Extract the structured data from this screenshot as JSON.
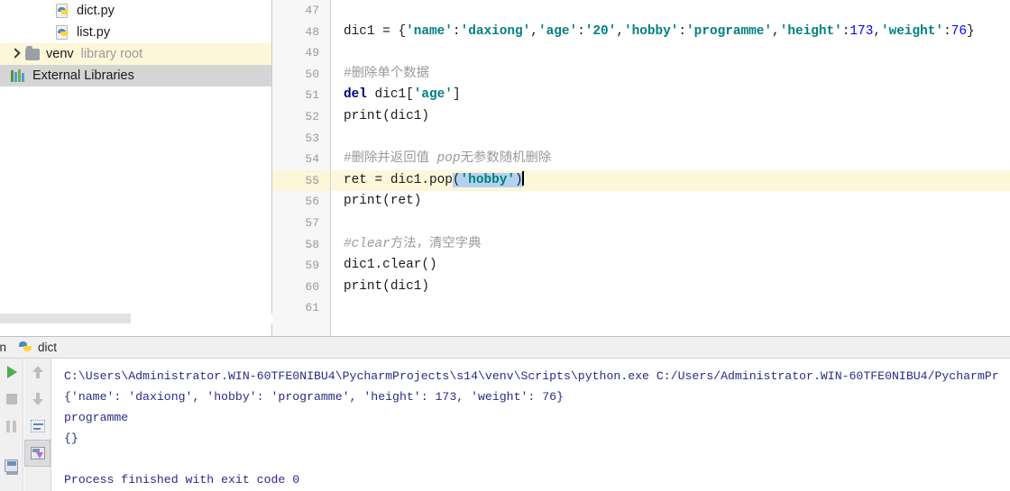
{
  "project_tree": {
    "items": [
      {
        "label": "dict.py",
        "sub": "",
        "icon": "python-file-icon",
        "indent": "indent3",
        "highlight": "none",
        "chevron": false
      },
      {
        "label": "list.py",
        "sub": "",
        "icon": "python-file-icon",
        "indent": "indent3",
        "highlight": "none",
        "chevron": false
      },
      {
        "label": "venv",
        "sub": "library root",
        "icon": "folder-icon",
        "indent": "indent1",
        "highlight": "hl-yellow",
        "chevron": true
      },
      {
        "label": "External Libraries",
        "sub": "",
        "icon": "books-icon",
        "indent": "indent0",
        "highlight": "hl-gray",
        "chevron": false
      }
    ]
  },
  "editor": {
    "first_line_number": 47,
    "current_line": 55,
    "lines": [
      {
        "n": 47,
        "tokens": []
      },
      {
        "n": 48,
        "tokens": [
          {
            "t": "plain",
            "s": "dic1 = {"
          },
          {
            "t": "str",
            "s": "'name'"
          },
          {
            "t": "plain",
            "s": ":"
          },
          {
            "t": "str",
            "s": "'daxiong'"
          },
          {
            "t": "plain",
            "s": ","
          },
          {
            "t": "str",
            "s": "'age'"
          },
          {
            "t": "plain",
            "s": ":"
          },
          {
            "t": "str",
            "s": "'20'"
          },
          {
            "t": "plain",
            "s": ","
          },
          {
            "t": "str",
            "s": "'hobby'"
          },
          {
            "t": "plain",
            "s": ":"
          },
          {
            "t": "str",
            "s": "'programme'"
          },
          {
            "t": "plain",
            "s": ","
          },
          {
            "t": "str",
            "s": "'height'"
          },
          {
            "t": "plain",
            "s": ":"
          },
          {
            "t": "num",
            "s": "173"
          },
          {
            "t": "plain",
            "s": ","
          },
          {
            "t": "str",
            "s": "'weight'"
          },
          {
            "t": "plain",
            "s": ":"
          },
          {
            "t": "num",
            "s": "76"
          },
          {
            "t": "plain",
            "s": "}"
          }
        ]
      },
      {
        "n": 49,
        "tokens": []
      },
      {
        "n": 50,
        "tokens": [
          {
            "t": "cmt",
            "s": "#删除单个数据"
          }
        ]
      },
      {
        "n": 51,
        "tokens": [
          {
            "t": "kw",
            "s": "del"
          },
          {
            "t": "plain",
            "s": " dic1["
          },
          {
            "t": "str",
            "s": "'age'"
          },
          {
            "t": "plain",
            "s": "]"
          }
        ]
      },
      {
        "n": 52,
        "tokens": [
          {
            "t": "plain",
            "s": "print(dic1)"
          }
        ]
      },
      {
        "n": 53,
        "tokens": []
      },
      {
        "n": 54,
        "tokens": [
          {
            "t": "cmt",
            "s": "#删除并返回值 "
          },
          {
            "t": "cmt-i",
            "s": "pop"
          },
          {
            "t": "cmt",
            "s": "无参数随机删除"
          }
        ]
      },
      {
        "n": 55,
        "tokens": [
          {
            "t": "plain",
            "s": "ret = dic1.pop"
          },
          {
            "t": "sel-plain",
            "s": "("
          },
          {
            "t": "sel-str",
            "s": "'hobby'"
          },
          {
            "t": "sel-plain",
            "s": ")"
          },
          {
            "t": "caret",
            "s": ""
          }
        ]
      },
      {
        "n": 56,
        "tokens": [
          {
            "t": "plain",
            "s": "print(ret)"
          }
        ]
      },
      {
        "n": 57,
        "tokens": []
      },
      {
        "n": 58,
        "tokens": [
          {
            "t": "cmt-i",
            "s": "#clear"
          },
          {
            "t": "cmt",
            "s": "方法，清空字典"
          }
        ]
      },
      {
        "n": 59,
        "tokens": [
          {
            "t": "plain",
            "s": "dic1.clear()"
          }
        ]
      },
      {
        "n": 60,
        "tokens": [
          {
            "t": "plain",
            "s": "print(dic1)"
          }
        ]
      },
      {
        "n": 61,
        "tokens": []
      }
    ]
  },
  "run_panel": {
    "title": "un",
    "tab_label": "dict",
    "toolbar_left": [
      {
        "name": "rerun-button",
        "icon": "run-icon"
      },
      {
        "name": "stop-button",
        "icon": "stop-icon"
      },
      {
        "name": "pause-button",
        "icon": "pause-icon"
      },
      {
        "name": "print-button",
        "icon": "print-icon"
      }
    ],
    "toolbar_right": [
      {
        "name": "up-arrow-button",
        "icon": "arrow-up-icon"
      },
      {
        "name": "down-arrow-button",
        "icon": "arrow-down-icon"
      },
      {
        "name": "soft-wrap-button",
        "icon": "soft-wrap-icon"
      },
      {
        "name": "scroll-to-end-button",
        "icon": "scroll-to-end-icon"
      }
    ],
    "console_lines": [
      "C:\\Users\\Administrator.WIN-60TFE0NIBU4\\PycharmProjects\\s14\\venv\\Scripts\\python.exe C:/Users/Administrator.WIN-60TFE0NIBU4/PycharmPr",
      "{'name': 'daxiong', 'hobby': 'programme', 'height': 173, 'weight': 76}",
      "programme",
      "{}",
      "",
      "Process finished with exit code 0"
    ]
  },
  "colors": {
    "string": "#008080",
    "keyword": "#000080",
    "number": "#0000ff",
    "comment": "#9a9a9a",
    "current_line": "#fdf6d8",
    "selection": "#b4d2f0",
    "console_text": "#2a2a8c"
  }
}
